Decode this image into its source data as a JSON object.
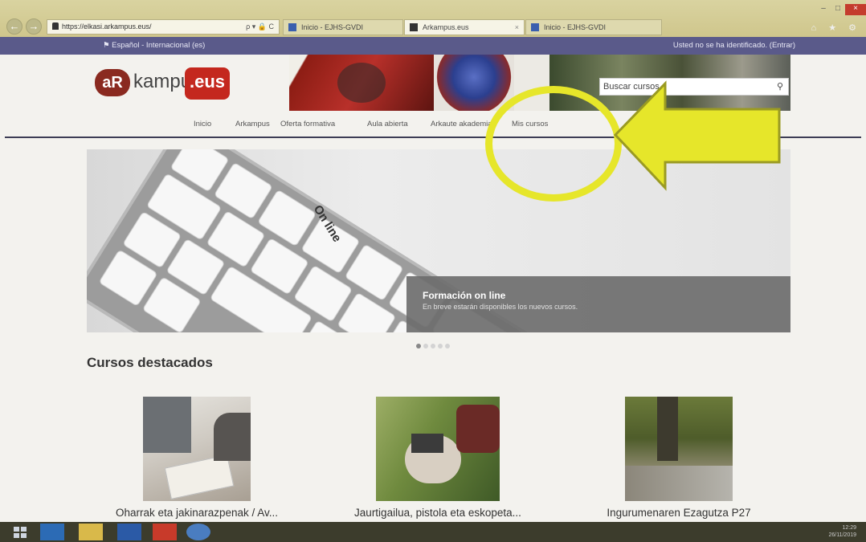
{
  "browser": {
    "url": "https://elkasi.arkampus.eus/",
    "url_tools": "ρ ▾ 🔒 C",
    "tabs": [
      {
        "label": "Inicio - EJHS-GVDI"
      },
      {
        "label": "Arkampus.eus",
        "active": true
      },
      {
        "label": "Inicio - EJHS-GVDI"
      }
    ],
    "tab_close": "×",
    "back": "←",
    "forward": "→",
    "icons": "⌂ ★ ⚙",
    "window": {
      "minimize": "‒",
      "maximize": "□",
      "close": "×"
    }
  },
  "site": {
    "language": "Español - Internacional (es)",
    "login_status": "Usted no se ha identificado. (Entrar)",
    "logo": {
      "ar": "aR",
      "kampus": "kampus",
      "eus": ".eus"
    },
    "search": {
      "placeholder": "Buscar cursos",
      "icon": "search-icon",
      "glyph": "⚲"
    },
    "nav": [
      {
        "label": "Inicio"
      },
      {
        "label": "Arkampus"
      },
      {
        "label": "Oferta formativa"
      },
      {
        "label": "Aula abierta"
      },
      {
        "label": "Arkaute akademia"
      },
      {
        "label": "Mis cursos"
      }
    ],
    "hero": {
      "title": "Formación on line",
      "subtitle": "En breve estarán disponibles los nuevos cursos.",
      "key_label": "On line",
      "slide_index": 1,
      "slide_count": 5
    },
    "featured_title": "Cursos destacados",
    "courses": [
      {
        "name": "Oharrak eta jakinarazpenak / Av..."
      },
      {
        "name": "Jaurtigailua, pistola eta eskopeta..."
      },
      {
        "name": "Ingurumenaren Ezagutza P27"
      }
    ]
  },
  "annotation": {
    "color": "#e6e62a",
    "arrow_color": "#e6e62a"
  },
  "taskbar": {
    "time": "12:29",
    "date": "26/11/2019"
  }
}
